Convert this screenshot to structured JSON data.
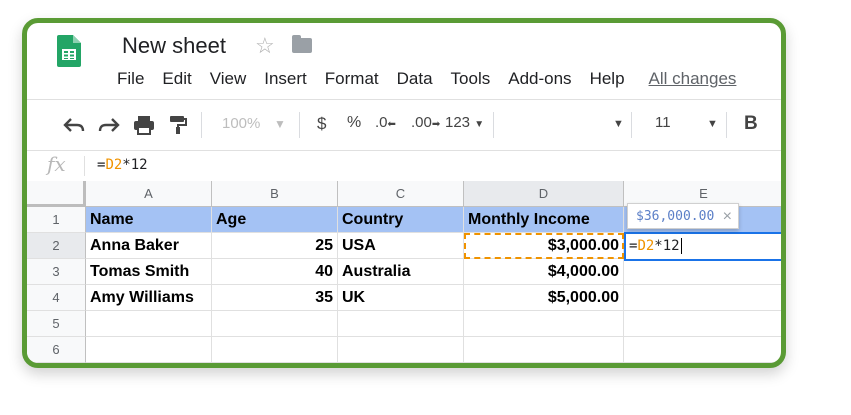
{
  "doc": {
    "title": "New sheet"
  },
  "menu": [
    "File",
    "Edit",
    "View",
    "Insert",
    "Format",
    "Data",
    "Tools",
    "Add-ons",
    "Help"
  ],
  "all_changes": "All changes",
  "toolbar": {
    "zoom": "100%",
    "currency": "$",
    "percent": "%",
    "dec_decrease": ".0",
    "dec_increase": ".00",
    "format_more": "123",
    "font_size": "11",
    "bold": "B"
  },
  "formula_bar": {
    "fx": "fx",
    "eq": "=",
    "ref": "D2",
    "rest": "*12"
  },
  "columns": [
    "A",
    "B",
    "C",
    "D",
    "E"
  ],
  "rows": [
    "1",
    "2",
    "3",
    "4",
    "5",
    "6"
  ],
  "cells": {
    "A1": "Name",
    "B1": "Age",
    "C1": "Country",
    "D1": "Monthly Income",
    "A2": "Anna Baker",
    "B2": "25",
    "C2": "USA",
    "D2": "$3,000.00",
    "A3": "Tomas Smith",
    "B3": "40",
    "C3": "Australia",
    "D3": "$4,000.00",
    "A4": "Amy Williams",
    "B4": "35",
    "C4": "UK",
    "D4": "$5,000.00"
  },
  "editor": {
    "eq": "=",
    "ref": "D2",
    "rest": "*12"
  },
  "tooltip": {
    "value": "$36,000.00",
    "close": "×"
  },
  "colors": {
    "frame": "#5a9b35",
    "header_fill": "#a4c2f4",
    "ref_color": "#f09300",
    "active_border": "#1a73e8"
  }
}
